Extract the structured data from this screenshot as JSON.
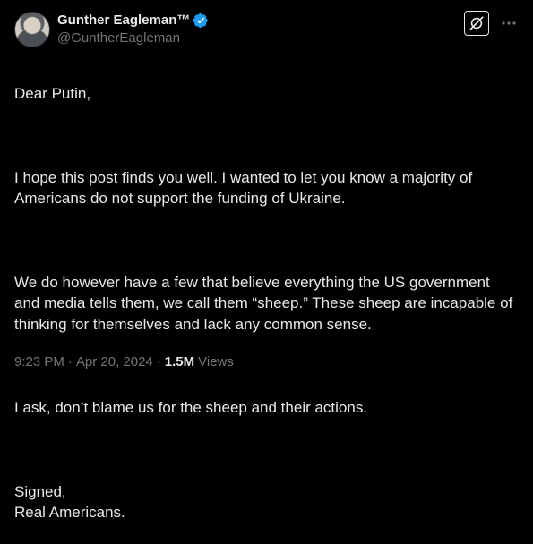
{
  "author": {
    "display_name": "Gunther Eagleman™",
    "handle": "@GuntherEagleman",
    "verified": true
  },
  "post": {
    "paragraphs": [
      "Dear Putin,",
      "I hope this post finds you well.  I wanted to let you know a majority of Americans do not support the funding of Ukraine.",
      "We do however have a few that believe everything the US government and media tells them, we call them “sheep.” These sheep are incapable of thinking for themselves and lack any common sense.",
      "I ask, don’t blame us for the sheep and their actions.",
      "Signed,\nReal Americans."
    ]
  },
  "meta": {
    "time": "9:23 PM",
    "date": "Apr 20, 2024",
    "separator": "·",
    "views_count": "1.5M",
    "views_label": "Views"
  },
  "colors": {
    "background": "#000000",
    "text": "#e7e9ea",
    "muted": "#71767b",
    "verified": "#1d9bf0"
  },
  "icons": {
    "verified": "verified-badge-icon",
    "grok": "grok-icon",
    "more": "more-horizontal-icon"
  }
}
